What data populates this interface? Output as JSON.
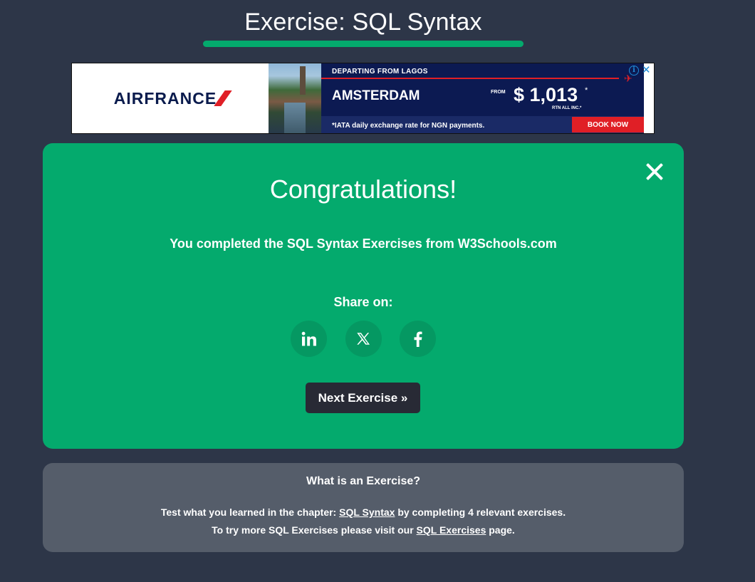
{
  "header": {
    "title": "Exercise: SQL Syntax"
  },
  "ad": {
    "brand": "AIRFRANCE",
    "departing": "DEPARTING FROM LAGOS",
    "destination": "AMSTERDAM",
    "from_label": "FROM",
    "price": "$ 1,013",
    "price_mark": "*",
    "price_note": "RTN ALL INC.*",
    "footnote": "*IATA daily exchange rate for NGN payments.",
    "cta": "BOOK NOW",
    "info_glyph": "i",
    "close_glyph": "✕"
  },
  "congrats": {
    "title": "Congratulations!",
    "message": "You completed the SQL Syntax Exercises from W3Schools.com",
    "share_label": "Share on:",
    "share_icons": [
      "linkedin-icon",
      "x-icon",
      "facebook-icon"
    ],
    "next_button": "Next Exercise »"
  },
  "info": {
    "title": "What is an Exercise?",
    "line1_before": "Test what you learned in the chapter: ",
    "line1_link": "SQL Syntax",
    "line1_after": " by completing 4 relevant exercises.",
    "line2_before": "To try more SQL Exercises please visit our ",
    "line2_link": "SQL Exercises",
    "line2_after": " page."
  },
  "colors": {
    "background": "#2d3648",
    "accent_green": "#04aa6d",
    "share_circle": "#059862",
    "next_button_bg": "#282a35",
    "info_card_bg": "#555d6a"
  }
}
